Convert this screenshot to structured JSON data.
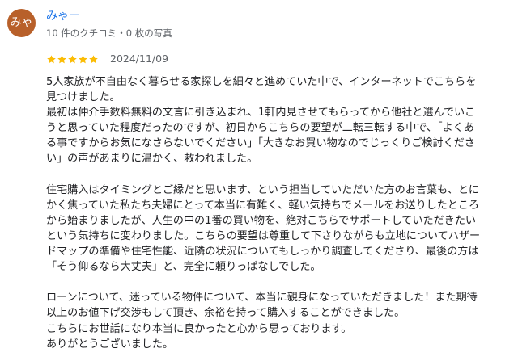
{
  "review": {
    "avatar_text": "みゃ",
    "avatar_color": "#b8602a",
    "reviewer_name": "みゃー",
    "reviewer_meta": "10 件のクチコミ・0 枚の写真",
    "rating": 5,
    "rating_max": 5,
    "star_color": "#fbbc04",
    "date": "2024/11/09",
    "lines": [
      "5人家族が不自由なく暮らせる家探しを細々と進めていた中で、インターネットでこちらを",
      "見つけました。",
      "最初は仲介手数料無料の文言に引き込まれ、1軒内見させてもらってから他社と選んでいこ",
      "うと思っていた程度だったのですが、初日からこちらの要望が二転三転する中で、「よくあ",
      "る事ですからお気になさらないでください」「大きなお買い物なのでじっくりご検討くださ",
      "い」の声があまりに温かく、救われました。",
      "",
      "住宅購入はタイミングとご縁だと思います、という担当していただいた方のお言葉も、とに",
      "かく焦っていた私たち夫婦にとって本当に有難く、軽い気持ちでメールをお送りしたところ",
      "から始まりましたが、人生の中の1番の買い物を、絶対こちらでサポートしていただきたい",
      "という気持ちに変わりました。こちらの要望は尊重して下さりながらも立地についてハザー",
      "ドマップの準備や住宅性能、近隣の状況についてもしっかり調査してくださり、最後の方は",
      "「そう仰るなら大丈夫」と、完全に頼りっぱなしでした。",
      "",
      "ローンについて、迷っている物件について、本当に親身になっていただきました！また期待",
      "以上のお値下げ交渉もして頂き、余裕を持って購入することができました。",
      "こちらにお世話になり本当に良かったと心から思っております。",
      "ありがとうございました。"
    ]
  }
}
